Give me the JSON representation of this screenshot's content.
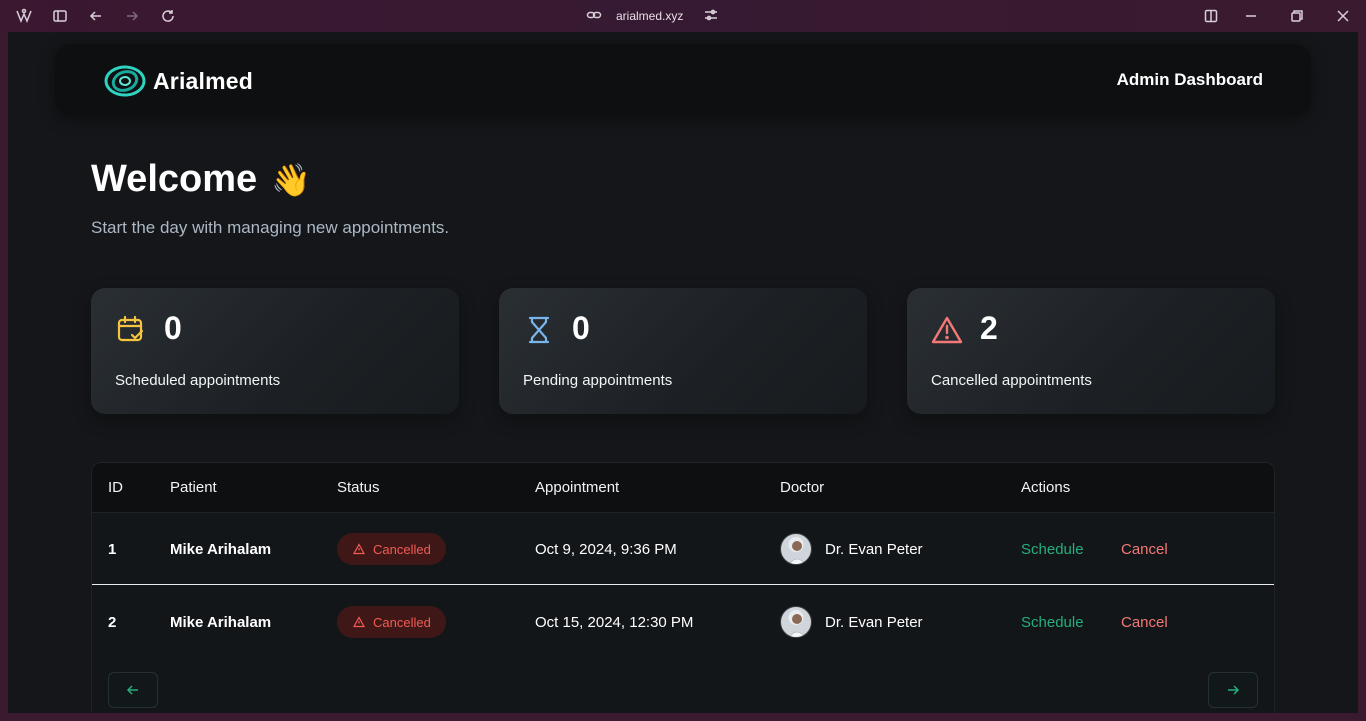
{
  "browser": {
    "url": "arialmed.xyz",
    "icons": [
      "app-icon",
      "sidebar-toggle-icon",
      "back-icon",
      "forward-icon",
      "reload-icon",
      "link-icon",
      "site-settings-icon",
      "split-view-icon",
      "minimize-icon",
      "restore-icon",
      "close-icon"
    ]
  },
  "header": {
    "logo_text": "Arialmed",
    "admin_title": "Admin Dashboard"
  },
  "welcome": {
    "title": "Welcome",
    "emoji": "👋",
    "subtitle": "Start the day with managing new appointments."
  },
  "stats": [
    {
      "icon": "calendar-check-icon",
      "value": "0",
      "label": "Scheduled appointments",
      "color": "#f5c542"
    },
    {
      "icon": "hourglass-icon",
      "value": "0",
      "label": "Pending appointments",
      "color": "#79b5ec"
    },
    {
      "icon": "warning-icon",
      "value": "2",
      "label": "Cancelled appointments",
      "color": "#f37877"
    }
  ],
  "table": {
    "headers": [
      "ID",
      "Patient",
      "Status",
      "Appointment",
      "Doctor",
      "Actions"
    ],
    "rows": [
      {
        "id": "1",
        "patient": "Mike Arihalam",
        "status": "Cancelled",
        "appointment": "Oct 9, 2024, 9:36 PM",
        "doctor": "Dr. Evan Peter",
        "schedule": "Schedule",
        "cancel": "Cancel"
      },
      {
        "id": "2",
        "patient": "Mike Arihalam",
        "status": "Cancelled",
        "appointment": "Oct 15, 2024, 12:30 PM",
        "doctor": "Dr. Evan Peter",
        "schedule": "Schedule",
        "cancel": "Cancel"
      }
    ]
  },
  "colors": {
    "accent_green": "#24ae7c",
    "cancel_red": "#f37877",
    "badge_bg": "#3e1716"
  }
}
